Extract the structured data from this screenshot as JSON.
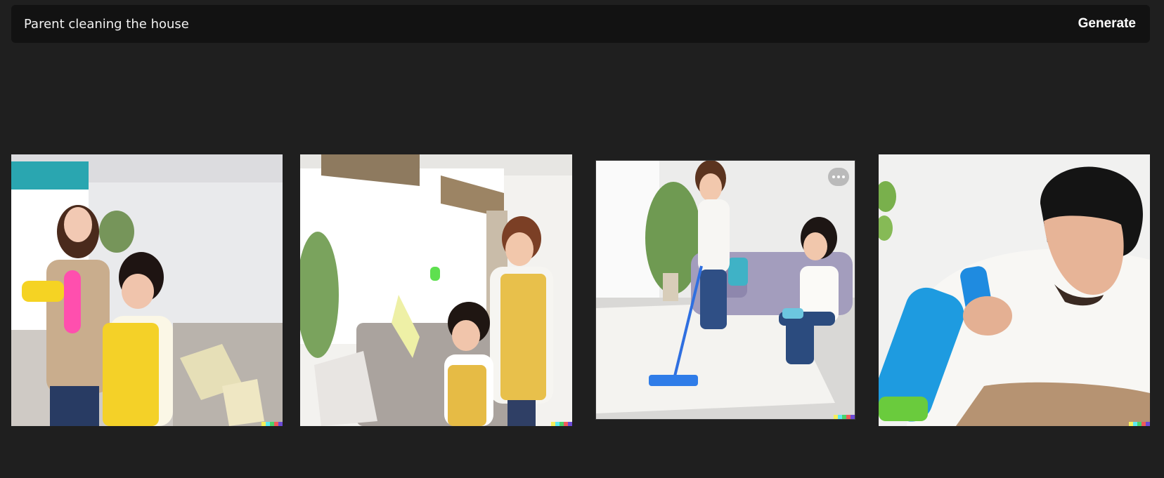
{
  "prompt": {
    "value": "Parent cleaning the house"
  },
  "toolbar": {
    "generate_label": "Generate"
  },
  "results": [
    {
      "alt": "Mother and daughter in aprons dusting the living room"
    },
    {
      "alt": "Mother and daughter spraying cleaner by the window"
    },
    {
      "alt": "Mother mopping the carpet while daughter sits on sofa"
    },
    {
      "alt": "Man spraying cleaner on a wooden table"
    }
  ],
  "signature_colors": [
    "#f7f05a",
    "#5ce8f0",
    "#4ad46b",
    "#f05a5a",
    "#6b4ad4"
  ],
  "colors": {
    "background": "#1f1f1f",
    "prompt_bg": "#121212",
    "text": "#f2f2f2"
  },
  "icons": {
    "more": "more-horizontal-icon"
  }
}
